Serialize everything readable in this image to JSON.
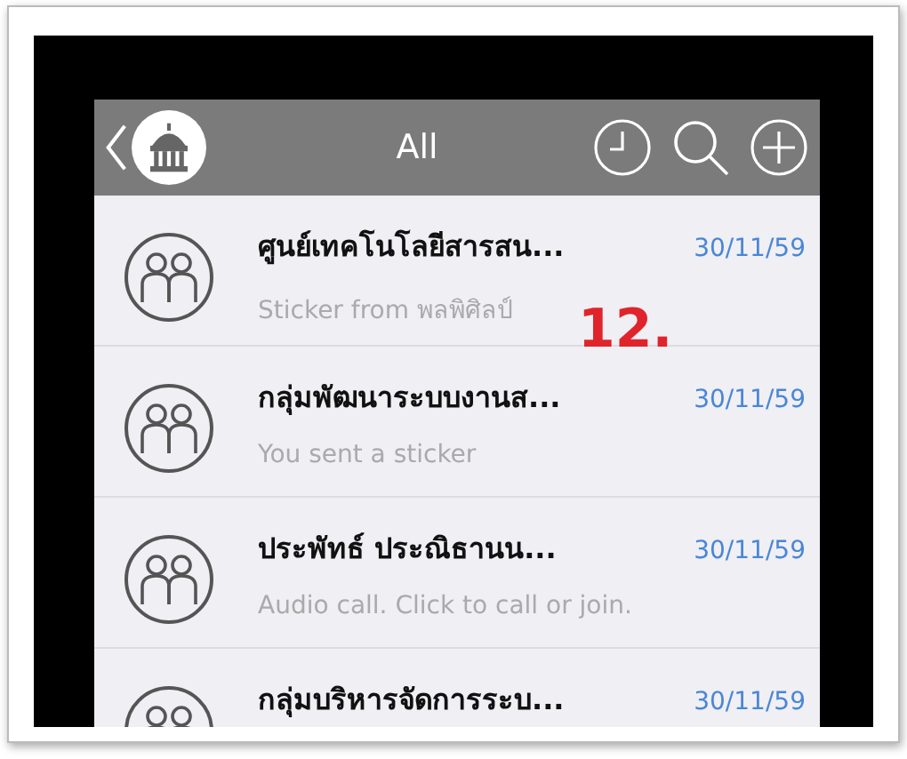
{
  "header": {
    "title": "All"
  },
  "chats": [
    {
      "name": "ศูนย์เทคโนโลยีสารสน...",
      "date": "30/11/59",
      "preview": "Sticker from พลพิศิลป์"
    },
    {
      "name": "กลุ่มพัฒนาระบบงานส...",
      "date": "30/11/59",
      "preview": "You sent a sticker"
    },
    {
      "name": "ประพัทธ์  ประณิธานน...",
      "date": "30/11/59",
      "preview": "Audio call. Click to call or join."
    },
    {
      "name": "กลุ่มบริหารจัดการระบ...",
      "date": "30/11/59"
    }
  ],
  "annotation": "12."
}
